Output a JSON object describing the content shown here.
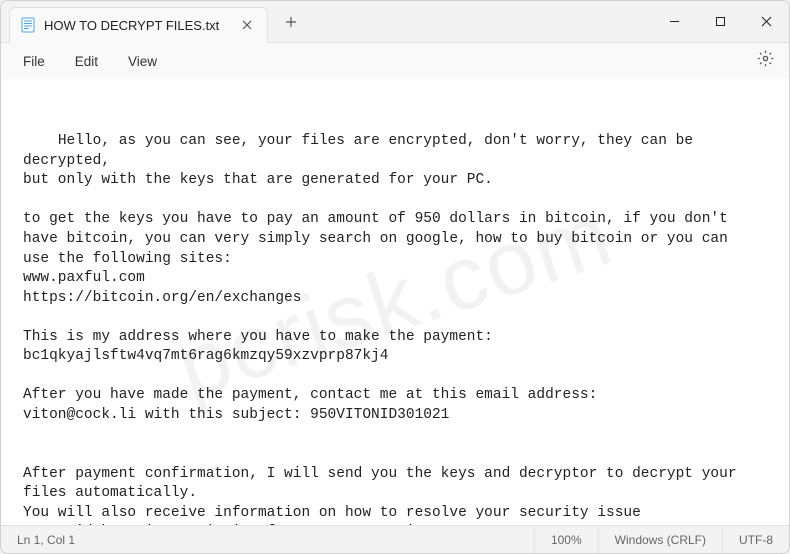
{
  "tab": {
    "title": "HOW TO DECRYPT FILES.txt"
  },
  "menu": {
    "file": "File",
    "edit": "Edit",
    "view": "View"
  },
  "body_text": "Hello, as you can see, your files are encrypted, don't worry, they can be decrypted,\nbut only with the keys that are generated for your PC.\n\nto get the keys you have to pay an amount of 950 dollars in bitcoin, if you don't\nhave bitcoin, you can very simply search on google, how to buy bitcoin or you can\nuse the following sites:\nwww.paxful.com\nhttps://bitcoin.org/en/exchanges\n\nThis is my address where you have to make the payment:\nbc1qkyajlsftw4vq7mt6rag6kmzqy59xzvprp87kj4\n\nAfter you have made the payment, contact me at this email address:\nviton@cock.li with this subject: 950VITONID301021\n\n\nAfter payment confirmation, I will send you the keys and decryptor to decrypt your\nfiles automatically.\nYou will also receive information on how to resolve your security issue\nto avoid becoming a victim of ransomware again.",
  "status": {
    "position": "Ln 1, Col 1",
    "zoom": "100%",
    "eol": "Windows (CRLF)",
    "encoding": "UTF-8"
  },
  "watermark": "pcrisk.com"
}
